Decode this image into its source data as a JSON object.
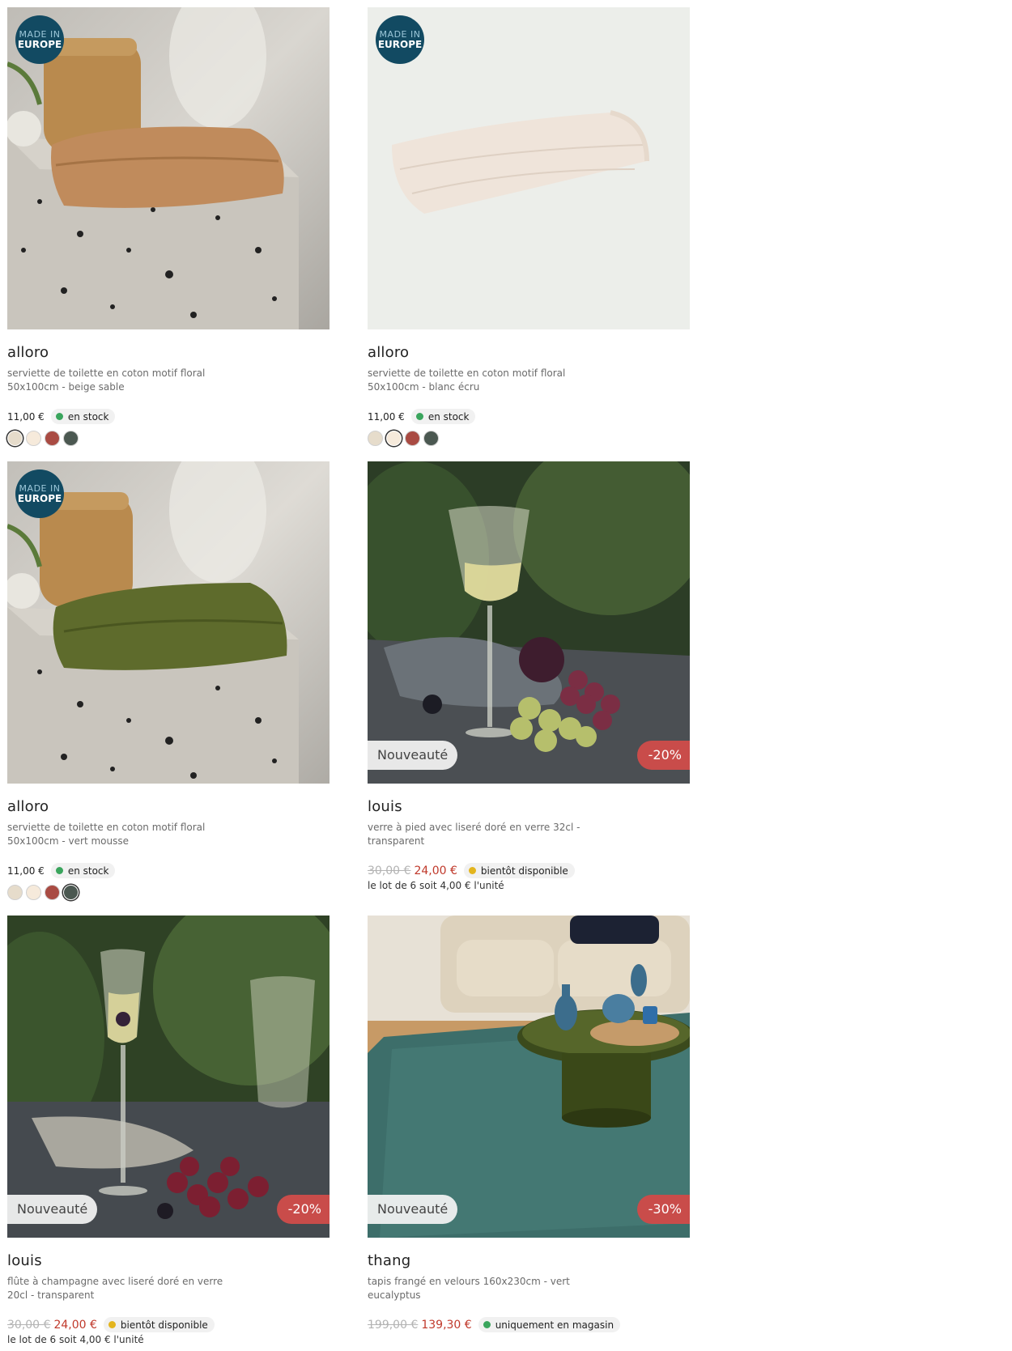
{
  "badges": {
    "made_in": "MADE IN",
    "europe": "EUROPE"
  },
  "products": [
    {
      "name": "alloro",
      "desc": "serviette de toilette en coton motif floral 50x100cm - beige sable",
      "price": "11,00 €",
      "stock": "en stock",
      "stock_color": "#3aa55d",
      "swatches": [
        "#e6dccb",
        "#f6eadb",
        "#a94b43",
        "#4b5851"
      ],
      "active_swatch": 0
    },
    {
      "name": "alloro",
      "desc": "serviette de toilette en coton motif floral 50x100cm - blanc écru",
      "price": "11,00 €",
      "stock": "en stock",
      "stock_color": "#3aa55d",
      "swatches": [
        "#e6dccb",
        "#f6eadb",
        "#a94b43",
        "#4b5851"
      ],
      "active_swatch": 1
    },
    {
      "name": "alloro",
      "desc": "serviette de toilette en coton motif floral 50x100cm - vert mousse",
      "price": "11,00 €",
      "stock": "en stock",
      "stock_color": "#3aa55d",
      "swatches": [
        "#e6dccb",
        "#f6eadb",
        "#a94b43",
        "#4b5851"
      ],
      "active_swatch": 3
    },
    {
      "name": "louis",
      "desc": "verre à pied avec liseré doré en verre 32cl - transparent",
      "old_price": "30,00 €",
      "new_price": "24,00 €",
      "stock": "bientôt disponible",
      "stock_color": "#e3b51e",
      "lot": "le lot de 6 soit 4,00 € l'unité",
      "new_label": "Nouveauté",
      "discount": "-20%"
    },
    {
      "name": "louis",
      "desc": "flûte à champagne avec liseré doré en verre 20cl - transparent",
      "old_price": "30,00 €",
      "new_price": "24,00 €",
      "stock": "bientôt disponible",
      "stock_color": "#e3b51e",
      "lot": "le lot de 6 soit 4,00 € l'unité",
      "new_label": "Nouveauté",
      "discount": "-20%"
    },
    {
      "name": "thang",
      "desc": "tapis frangé en velours 160x230cm - vert eucalyptus",
      "old_price": "199,00 €",
      "new_price": "139,30 €",
      "stock": "uniquement en magasin",
      "stock_color": "#3aa55d",
      "new_label": "Nouveauté",
      "discount": "-30%"
    }
  ]
}
